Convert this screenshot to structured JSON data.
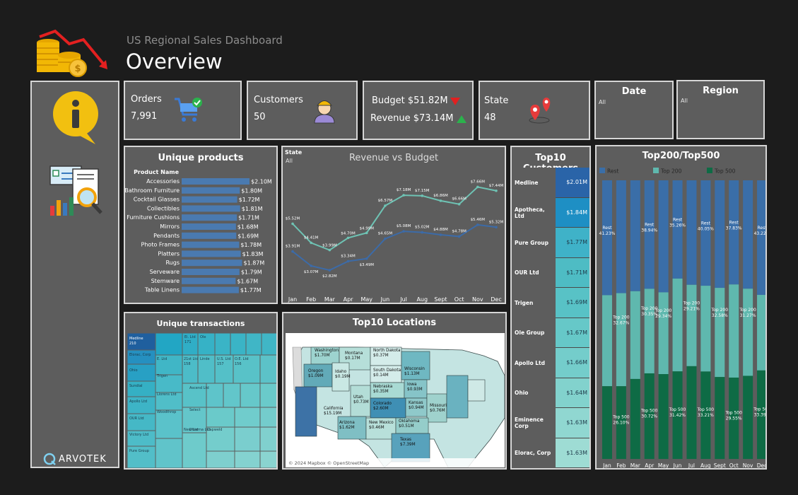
{
  "header": {
    "subtitle": "US Regional Sales Dashboard",
    "title": "Overview"
  },
  "sidebar": {
    "brand": "ARVOTEK"
  },
  "kpis": {
    "orders_label": "Orders",
    "orders_value": "7,991",
    "customers_label": "Customers",
    "customers_value": "50",
    "budget_text": "Budget $51.82M",
    "revenue_text": "Revenue  $73.14M",
    "state_label": "State",
    "state_value": "48"
  },
  "filters": {
    "date_label": "Date",
    "date_value": "All",
    "region_label": "Region",
    "region_value": "All"
  },
  "colors": {
    "background": "#1c1c1c",
    "panel": "#5d5d5d",
    "bar_blue": "#4a7ab0",
    "line_revenue": "#6ec3b4",
    "line_budget": "#3c6ba8",
    "rest": "#3a6ea8",
    "top200": "#5fb8ae",
    "top500": "#0e6b45",
    "down": "#e02020",
    "up": "#2bb24c"
  },
  "chart_data": [
    {
      "id": "unique_products",
      "type": "bar",
      "title": "Unique products",
      "column_header": "Product Name",
      "categories": [
        "Accessories",
        "Bathroom Furniture",
        "Cocktail Glasses",
        "Collectibles",
        "Furniture Cushions",
        "Mirrors",
        "Pendants",
        "Photo Frames",
        "Platters",
        "Rugs",
        "Serveware",
        "Stemware",
        "Table Linens"
      ],
      "values": [
        2.1,
        1.8,
        1.72,
        1.81,
        1.71,
        1.68,
        1.69,
        1.78,
        1.83,
        1.87,
        1.79,
        1.67,
        1.77
      ],
      "labels": [
        "$2.10M",
        "$1.80M",
        "$1.72M",
        "$1.81M",
        "$1.71M",
        "$1.68M",
        "$1.69M",
        "$1.78M",
        "$1.83M",
        "$1.87M",
        "$1.79M",
        "$1.67M",
        "$1.77M"
      ],
      "xlim": [
        0,
        2.1
      ]
    },
    {
      "id": "revenue_vs_budget",
      "type": "line",
      "title": "Revenue vs Budget",
      "filter_label": "State",
      "filter_value": "All",
      "categories": [
        "Jan",
        "Feb",
        "Mar",
        "Apr",
        "May",
        "Jun",
        "Jul",
        "Aug",
        "Sept",
        "Oct",
        "Nov",
        "Dec"
      ],
      "series": [
        {
          "values": [
            5.52,
            4.41,
            3.99,
            4.7,
            4.99,
            6.57,
            7.18,
            7.15,
            6.86,
            6.66,
            7.66,
            7.44
          ],
          "labels": [
            "$5.52M",
            "$4.41M",
            "$3.99M",
            "$4.70M",
            "$4.99M",
            "$6.57M",
            "$7.18M",
            "$7.15M",
            "$6.86M",
            "$6.66M",
            "$7.66M",
            "$7.44M"
          ]
        },
        {
          "values": [
            3.91,
            3.07,
            2.82,
            3.34,
            3.49,
            4.65,
            5.08,
            5.02,
            4.88,
            4.78,
            5.46,
            5.32
          ],
          "labels": [
            "$3.91M",
            "$3.07M",
            "$2.82M",
            "$3.34M",
            "$3.49M",
            "$4.65M",
            "$5.08M",
            "$5.02M",
            "$4.88M",
            "$4.78M",
            "$5.46M",
            "$5.32M"
          ]
        }
      ],
      "ylim": [
        2.0,
        8.5
      ]
    },
    {
      "id": "top10_customers",
      "type": "table",
      "title": "Top10 Customers",
      "rows": [
        {
          "name": "Medline",
          "value": "$2.01M"
        },
        {
          "name": "Apotheca, Ltd",
          "value": "$1.84M"
        },
        {
          "name": "Pure Group",
          "value": "$1.77M"
        },
        {
          "name": "OUR Ltd",
          "value": "$1.71M"
        },
        {
          "name": "Trigen",
          "value": "$1.69M"
        },
        {
          "name": "Ole Group",
          "value": "$1.67M"
        },
        {
          "name": "Apollo Ltd",
          "value": "$1.66M"
        },
        {
          "name": "Ohio",
          "value": "$1.64M"
        },
        {
          "name": "Eminence Corp",
          "value": "$1.63M"
        },
        {
          "name": "Elorac, Corp",
          "value": "$1.63M"
        }
      ]
    },
    {
      "id": "top200_top500",
      "type": "bar",
      "title": "Top200/Top500",
      "legend": [
        "Rest",
        "Top 200",
        "Top 500"
      ],
      "categories": [
        "Jan",
        "Feb",
        "Mar",
        "Apr",
        "May",
        "Jun",
        "Jul",
        "Aug",
        "Sept",
        "Oct",
        "Nov",
        "Dec"
      ],
      "series": [
        {
          "name": "Rest",
          "values": [
            41.23,
            40.5,
            39.8,
            38.94,
            40.2,
            35.26,
            37.5,
            40.05,
            38.6,
            37.83,
            38.9,
            43.22
          ]
        },
        {
          "name": "Top 200",
          "values": [
            32.67,
            33.4,
            31.5,
            30.35,
            29.34,
            33.3,
            29.21,
            32.58,
            32.0,
            33.83,
            31.27,
            28.5
          ]
        },
        {
          "name": "Top 500",
          "values": [
            26.1,
            26.1,
            28.7,
            30.72,
            30.44,
            31.42,
            33.29,
            33.21,
            29.4,
            29.55,
            29.83,
            33.39
          ]
        }
      ],
      "labels": {
        "rest": [
          {
            "i": 0,
            "text": "Rest\n41.23%"
          },
          {
            "i": 3,
            "text": "Rest\n38.94%"
          },
          {
            "i": 5,
            "text": "Rest\n35.26%"
          },
          {
            "i": 7,
            "text": "Rest\n40.05%"
          },
          {
            "i": 9,
            "text": "Rest\n37.83%"
          },
          {
            "i": 11,
            "text": "Rest\n43.22%"
          }
        ],
        "top200": [
          {
            "i": 1,
            "text": "Top 200\n32.67%"
          },
          {
            "i": 3,
            "text": "Top 200\n30.35%"
          },
          {
            "i": 4,
            "text": "Top 200\n29.34%"
          },
          {
            "i": 6,
            "text": "Top 200\n29.21%"
          },
          {
            "i": 8,
            "text": "Top 200\n32.58%"
          },
          {
            "i": 10,
            "text": "Top 200\n31.27%"
          }
        ],
        "top500": [
          {
            "i": 1,
            "text": "Top 500\n26.10%"
          },
          {
            "i": 3,
            "text": "Top 500\n30.72%"
          },
          {
            "i": 5,
            "text": "Top 500\n31.42%"
          },
          {
            "i": 7,
            "text": "Top 500\n33.21%"
          },
          {
            "i": 9,
            "text": "Top 500\n29.55%"
          },
          {
            "i": 11,
            "text": "Top 500\n33.39%"
          }
        ]
      }
    },
    {
      "id": "unique_transactions",
      "type": "heatmap",
      "title": "Unique transactions",
      "cells": [
        "Medline\n210",
        "Elorac, Corp",
        "Ohio",
        "Sundial",
        "Apollo Ltd",
        "OUR Ltd",
        "Victory Ltd",
        "Pure Group",
        "E. Ltd",
        "Trigen",
        "Llorens Ltd",
        "Woodthrop",
        "New Ltd",
        "21st Ltd\n158",
        "Linde",
        "U.S. Ltd\n157",
        "O.E. Ltd\n156",
        "Ei. Ltd\n171",
        "Ole",
        "Ascend Ltd",
        "Select",
        "Dharma Ltd",
        "Capweld"
      ]
    },
    {
      "id": "top10_locations",
      "type": "table",
      "title": "Top10 Locations",
      "attribution": "© 2024 Mapbox © OpenStreetMap",
      "states": [
        {
          "name": "Washington",
          "value": "$1.70M"
        },
        {
          "name": "Montana",
          "value": "$0.17M"
        },
        {
          "name": "North Dakota",
          "value": "$0.37M"
        },
        {
          "name": "Oregon",
          "value": "$1.09M"
        },
        {
          "name": "Idaho",
          "value": "$0.19M"
        },
        {
          "name": "South Dakota",
          "value": "$0.14M"
        },
        {
          "name": "Wisconsin",
          "value": "$1.13M"
        },
        {
          "name": "Nebraska",
          "value": "$0.35M"
        },
        {
          "name": "Iowa",
          "value": "$0.93M"
        },
        {
          "name": "Utah",
          "value": "$0.73M"
        },
        {
          "name": "Colorado",
          "value": "$2.60M"
        },
        {
          "name": "Kansas",
          "value": "$0.94M"
        },
        {
          "name": "Missouri",
          "value": "$0.76M"
        },
        {
          "name": "California",
          "value": "$15.19M"
        },
        {
          "name": "Arizona",
          "value": "$1.62M"
        },
        {
          "name": "New Mexico",
          "value": "$0.46M"
        },
        {
          "name": "Oklahoma",
          "value": "$0.51M"
        },
        {
          "name": "Texas",
          "value": "$7.39M"
        }
      ]
    }
  ]
}
